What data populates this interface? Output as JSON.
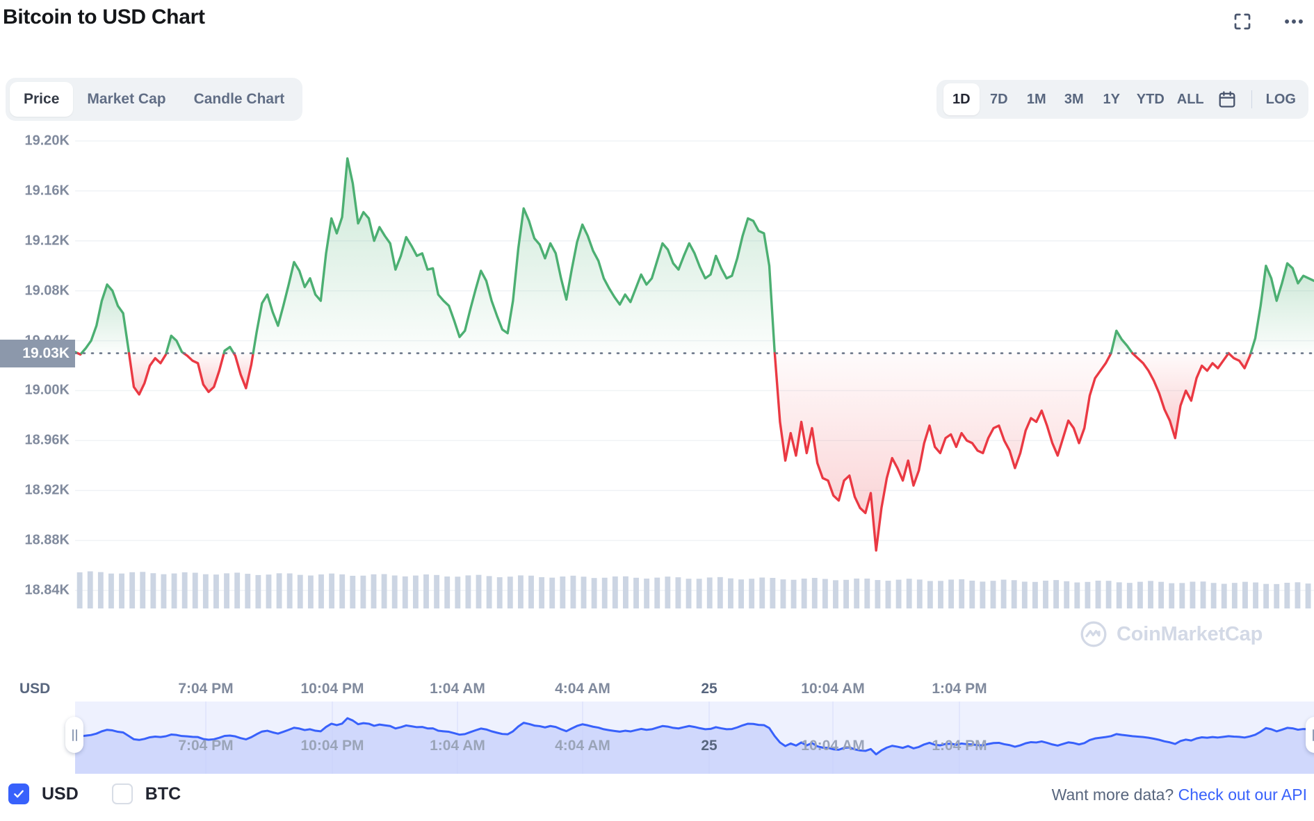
{
  "header": {
    "title": "Bitcoin to USD Chart",
    "icons": [
      {
        "name": "fullscreen-icon",
        "label": "fullscreen"
      },
      {
        "name": "more-options-icon",
        "label": "more"
      }
    ]
  },
  "toolbar": {
    "view_tabs": [
      {
        "label": "Price",
        "active": true
      },
      {
        "label": "Market Cap",
        "active": false
      },
      {
        "label": "Candle Chart",
        "active": false
      }
    ],
    "ranges": [
      {
        "label": "1D",
        "active": true
      },
      {
        "label": "7D",
        "active": false
      },
      {
        "label": "1M",
        "active": false
      },
      {
        "label": "3M",
        "active": false
      },
      {
        "label": "1Y",
        "active": false
      },
      {
        "label": "YTD",
        "active": false
      },
      {
        "label": "ALL",
        "active": false
      }
    ],
    "calendar_icon": "calendar-icon",
    "log_label": "LOG"
  },
  "footer": {
    "currencies": [
      {
        "label": "USD",
        "checked": true
      },
      {
        "label": "BTC",
        "checked": false
      }
    ],
    "api_prompt": "Want more data?",
    "api_link": "Check out our API"
  },
  "watermark": {
    "text": "CoinMarketCap",
    "icon": "coinmarketcap-logo-icon"
  },
  "colors": {
    "up": "#4caf72",
    "down": "#ea3943",
    "accent": "#3861fb",
    "axis_text": "#808a9d",
    "badge_bg": "#8c98ab",
    "volume_bar": "#ccd5e3",
    "navigator_line": "#3861fb",
    "navigator_fill": "#c5cffb",
    "grid": "#eff2f5"
  },
  "chart_data": {
    "type": "line",
    "title": "Bitcoin to USD Chart",
    "xlabel": "",
    "ylabel": "USD",
    "currency": "USD",
    "grid": true,
    "legend_position": "bottom-left",
    "ylim": [
      18820,
      19215
    ],
    "yticks": [
      19200,
      19160,
      19120,
      19080,
      19040,
      19000,
      18960,
      18920,
      18880,
      18840
    ],
    "ytick_labels": [
      "19.20K",
      "19.16K",
      "19.12K",
      "19.08K",
      "19.04K",
      "19.00K",
      "18.96K",
      "18.92K",
      "18.88K",
      "18.84K"
    ],
    "xtick_labels": [
      "7:04 PM",
      "10:04 PM",
      "1:04 AM",
      "4:04 AM",
      "25",
      "10:04 AM",
      "1:04 PM"
    ],
    "reference_line": {
      "value": 19030,
      "label": "19.03K",
      "style": "dotted"
    },
    "series": [
      {
        "name": "Price (USD)",
        "color_up": "#4caf72",
        "color_down": "#ea3943",
        "values": [
          19031,
          19029,
          19034,
          19040,
          19052,
          19072,
          19085,
          19080,
          19068,
          19062,
          19033,
          19003,
          18997,
          19006,
          19020,
          19026,
          19022,
          19029,
          19044,
          19040,
          19031,
          19028,
          19024,
          19022,
          19005,
          18999,
          19003,
          19016,
          19032,
          19035,
          19028,
          19013,
          19002,
          19021,
          19047,
          19070,
          19077,
          19063,
          19052,
          19068,
          19085,
          19103,
          19096,
          19083,
          19090,
          19077,
          19072,
          19110,
          19138,
          19126,
          19139,
          19186,
          19166,
          19134,
          19143,
          19138,
          19120,
          19131,
          19124,
          19118,
          19097,
          19108,
          19123,
          19116,
          19108,
          19110,
          19097,
          19098,
          19077,
          19072,
          19068,
          19056,
          19043,
          19048,
          19065,
          19081,
          19096,
          19088,
          19072,
          19060,
          19049,
          19046,
          19072,
          19114,
          19146,
          19136,
          19122,
          19117,
          19106,
          19118,
          19110,
          19090,
          19073,
          19097,
          19119,
          19133,
          19124,
          19112,
          19104,
          19090,
          19082,
          19075,
          19069,
          19077,
          19071,
          19082,
          19093,
          19085,
          19090,
          19104,
          19118,
          19113,
          19102,
          19097,
          19108,
          19118,
          19110,
          19099,
          19090,
          19093,
          19108,
          19098,
          19090,
          19092,
          19106,
          19124,
          19138,
          19136,
          19128,
          19126,
          19100,
          19031,
          18975,
          18944,
          18966,
          18948,
          18975,
          18950,
          18970,
          18942,
          18930,
          18928,
          18916,
          18912,
          18928,
          18932,
          18915,
          18906,
          18902,
          18918,
          18872,
          18906,
          18930,
          18946,
          18938,
          18928,
          18944,
          18924,
          18936,
          18958,
          18972,
          18955,
          18950,
          18962,
          18965,
          18955,
          18966,
          18960,
          18958,
          18952,
          18950,
          18962,
          18970,
          18972,
          18960,
          18952,
          18938,
          18950,
          18968,
          18978,
          18975,
          18984,
          18972,
          18958,
          18948,
          18962,
          18976,
          18970,
          18958,
          18970,
          18996,
          19010,
          19016,
          19022,
          19030,
          19048,
          19041,
          19036,
          19030,
          19026,
          19022,
          19016,
          19008,
          18998,
          18985,
          18976,
          18962,
          18988,
          19000,
          18992,
          19010,
          19020,
          19016,
          19022,
          19018,
          19024,
          19030,
          19026,
          19024,
          19018,
          19028,
          19042,
          19068,
          19100,
          19090,
          19072,
          19086,
          19102,
          19098,
          19086,
          19092,
          19090,
          19088
        ]
      }
    ],
    "volume": {
      "name": "Volume",
      "color": "#ccd5e3",
      "trend": "slowly declining left to right"
    },
    "navigator": {
      "line_color": "#3861fb",
      "fill_color": "#c5cffb",
      "selection": "full-range",
      "xtick_labels": [
        "7:04 PM",
        "10:04 PM",
        "1:04 AM",
        "4:04 AM",
        "25",
        "10:04 AM",
        "1:04 PM"
      ]
    }
  }
}
